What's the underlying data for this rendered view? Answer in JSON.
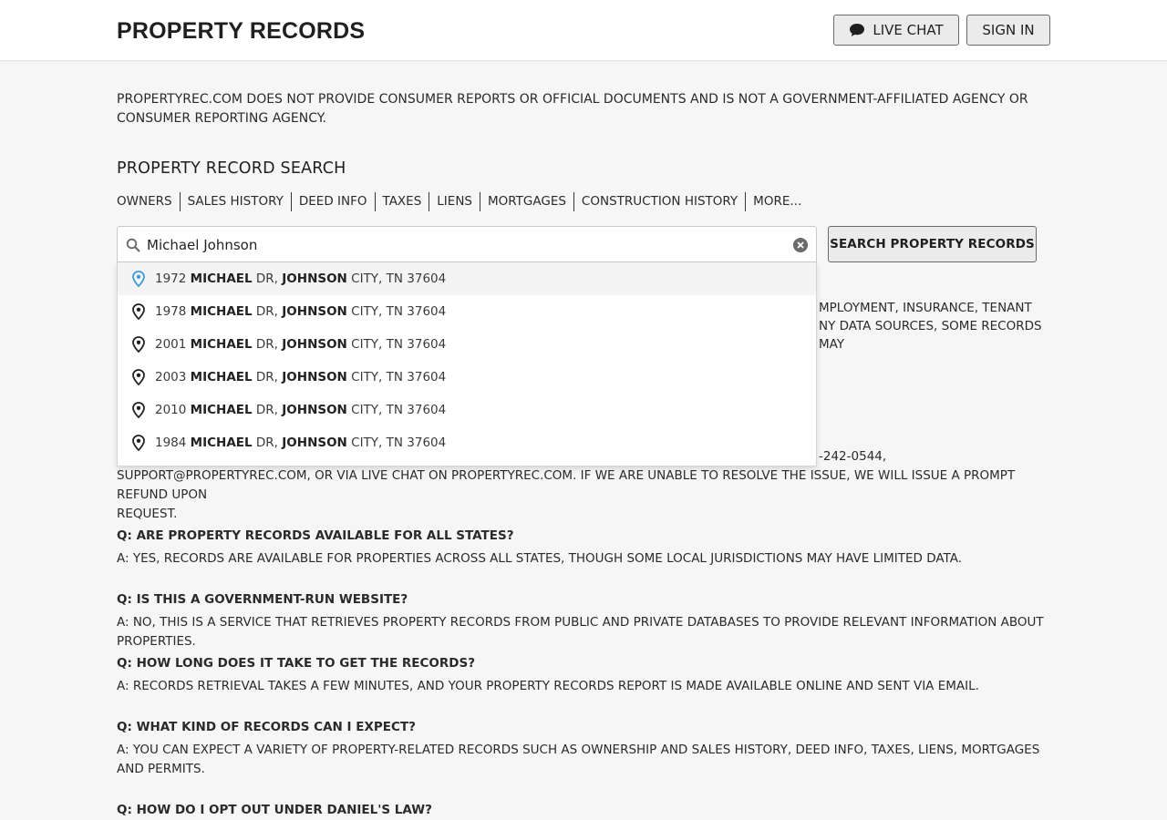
{
  "header": {
    "brand": "PROPERTY RECORDS",
    "chat_label": "LIVE CHAT",
    "signin_label": "SIGN IN"
  },
  "disclaimer": "PROPERTYREC.COM DOES NOT PROVIDE CONSUMER REPORTS OR OFFICIAL DOCUMENTS AND IS NOT A GOVERNMENT-AFFILIATED AGENCY OR CONSUMER REPORTING AGENCY.",
  "search": {
    "title": "PROPERTY RECORD SEARCH",
    "tabs": [
      "OWNERS",
      "SALES HISTORY",
      "DEED INFO",
      "TAXES",
      "LIENS",
      "MORTGAGES",
      "CONSTRUCTION HISTORY",
      "MORE..."
    ],
    "value": "Michael Johnson",
    "button_label": "SEARCH PROPERTY RECORDS"
  },
  "suggestions": [
    {
      "num": "1972",
      "street": "MICHAEL",
      "suffix": "DR,",
      "city": "JOHNSON",
      "rest": "CITY, TN 37604"
    },
    {
      "num": "1978",
      "street": "MICHAEL",
      "suffix": "DR,",
      "city": "JOHNSON",
      "rest": "CITY, TN 37604"
    },
    {
      "num": "2001",
      "street": "MICHAEL",
      "suffix": "DR,",
      "city": "JOHNSON",
      "rest": "CITY, TN 37604"
    },
    {
      "num": "2003",
      "street": "MICHAEL",
      "suffix": "DR,",
      "city": "JOHNSON",
      "rest": "CITY, TN 37604"
    },
    {
      "num": "2010",
      "street": "MICHAEL",
      "suffix": "DR,",
      "city": "JOHNSON",
      "rest": "CITY, TN 37604"
    },
    {
      "num": "1984",
      "street": "MICHAEL",
      "suffix": "DR,",
      "city": "JOHNSON",
      "rest": "CITY, TN 37604"
    }
  ],
  "partial": {
    "line1": "MPLOYMENT, INSURANCE, TENANT",
    "line2": "NY DATA SOURCES, SOME RECORDS MAY",
    "support_l1": "-242-0544,",
    "support_l2": "SUPPORT@PROPERTYREC.COM, OR VIA LIVE CHAT ON PROPERTYREC.COM. IF WE ARE UNABLE TO RESOLVE THE ISSUE, WE WILL ISSUE A PROMPT REFUND UPON",
    "support_l3": "REQUEST."
  },
  "faq": [
    {
      "q": "Q: ARE PROPERTY RECORDS AVAILABLE FOR ALL STATES?",
      "a": "A: YES, RECORDS ARE AVAILABLE FOR PROPERTIES ACROSS ALL STATES, THOUGH SOME LOCAL JURISDICTIONS MAY HAVE LIMITED DATA."
    },
    {
      "q": "Q: IS THIS A GOVERNMENT-RUN WEBSITE?",
      "a": "A: NO, THIS IS A SERVICE THAT RETRIEVES PROPERTY RECORDS FROM PUBLIC AND PRIVATE DATABASES TO PROVIDE RELEVANT INFORMATION ABOUT PROPERTIES."
    },
    {
      "q": "Q: HOW LONG DOES IT TAKE TO GET THE RECORDS?",
      "a": "A: RECORDS RETRIEVAL TAKES A FEW MINUTES, AND YOUR PROPERTY RECORDS REPORT IS MADE AVAILABLE ONLINE AND SENT VIA EMAIL."
    },
    {
      "q": "Q: WHAT KIND OF RECORDS CAN I EXPECT?",
      "a": "A: YOU CAN EXPECT A VARIETY OF PROPERTY-RELATED RECORDS SUCH AS OWNERSHIP AND SALES HISTORY, DEED INFO, TAXES, LIENS, MORTGAGES AND PERMITS."
    },
    {
      "q": "Q: HOW DO I OPT OUT UNDER DANIEL'S LAW?",
      "a": ""
    }
  ],
  "colors": {
    "active_pin": "#3b9bd8",
    "pin": "#222222",
    "background": "#f6f6f6"
  }
}
